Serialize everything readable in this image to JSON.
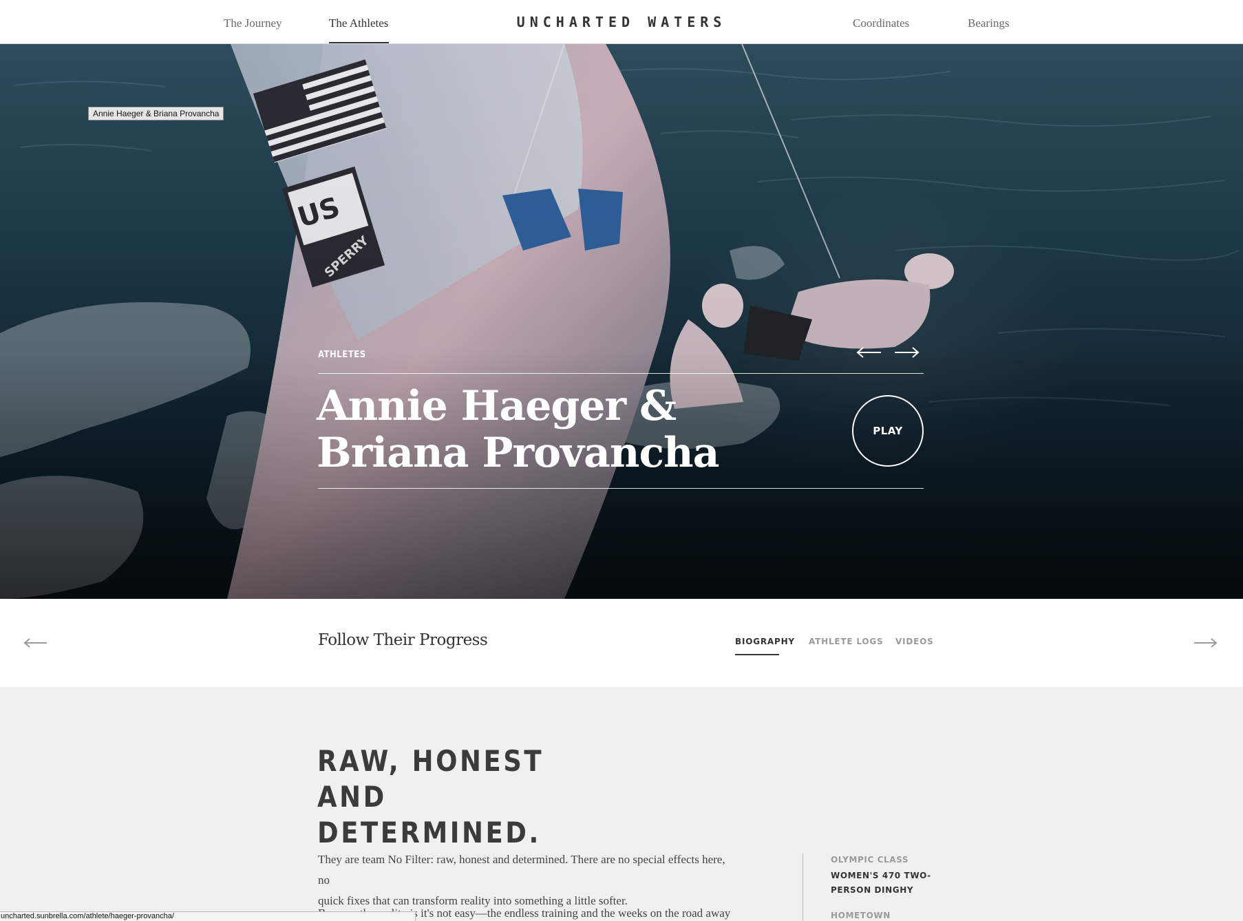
{
  "site": {
    "logo": "UNCHARTED WATERS"
  },
  "topnav": {
    "items": [
      {
        "label": "The Journey",
        "active": false
      },
      {
        "label": "The Athletes",
        "active": true
      },
      {
        "label": "Coordinates",
        "active": false
      },
      {
        "label": "Bearings",
        "active": false
      }
    ]
  },
  "hero": {
    "tooltip": "Annie Haeger & Briana Provancha",
    "eyebrow": "ATHLETES",
    "name_line1": "Annie Haeger &",
    "name_line2": "Briana Provancha",
    "play_label": "PLAY",
    "prev_icon": "arrow-left-icon",
    "next_icon": "arrow-right-icon"
  },
  "subnav": {
    "title": "Follow Their Progress",
    "tabs": [
      {
        "label": "BIOGRAPHY",
        "active": true
      },
      {
        "label": "ATHLETE LOGS",
        "active": false
      },
      {
        "label": "VIDEOS",
        "active": false
      }
    ]
  },
  "bio": {
    "headline_line1": "RAW, HONEST AND",
    "headline_line2": "DETERMINED.",
    "paragraph1_line1": "They are team No Filter: raw, honest and determined. There are no special effects here, no",
    "paragraph1_line2": "quick fixes that can transform reality into something a little softer.",
    "paragraph2_line1": "Because the reality is it's not easy—the endless training and the weeks on the road away"
  },
  "meta": {
    "class_label": "OLYMPIC CLASS",
    "class_value_line1": "WOMEN'S 470 TWO-",
    "class_value_line2": "PERSON DINGHY",
    "hometown_label": "HOMETOWN"
  },
  "status_url": "uncharted.sunbrella.com/athlete/haeger-provancha/",
  "colors": {
    "text_dark": "#333333",
    "text_muted": "#9a9a9a",
    "content_bg": "#f0f0f0",
    "water_dark": "#122733"
  }
}
